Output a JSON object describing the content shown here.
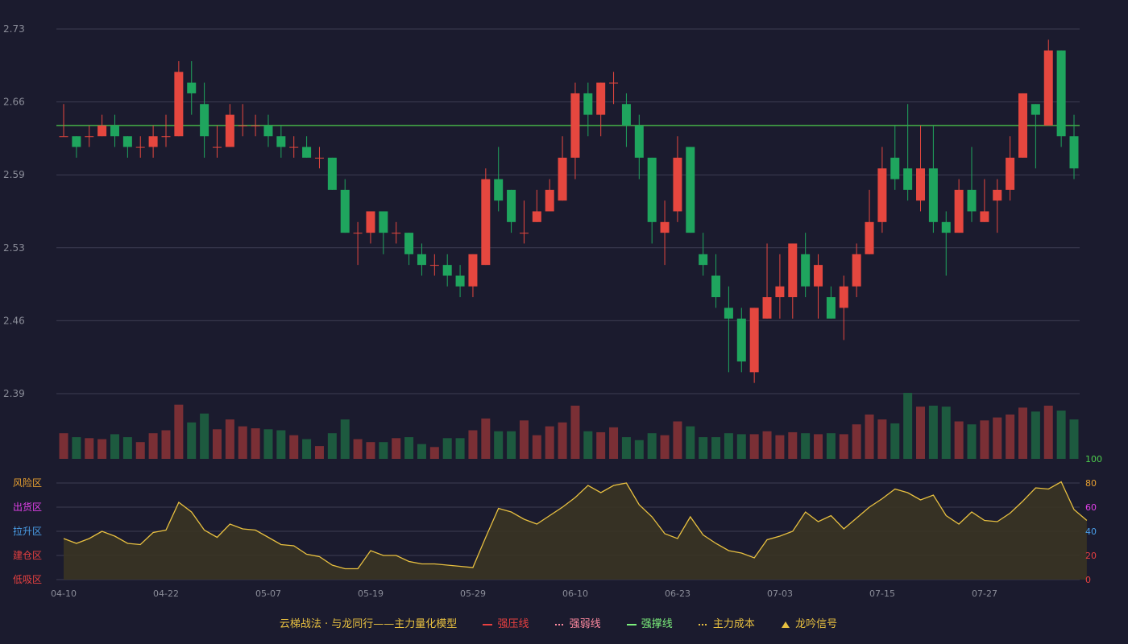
{
  "chart_data": {
    "type": "candlestick",
    "x_labels": [
      "04-10",
      "04-22",
      "05-07",
      "05-19",
      "05-29",
      "06-10",
      "06-23",
      "07-03",
      "07-15",
      "07-27"
    ],
    "price_axis": {
      "ticks": [
        "2.73",
        "2.66",
        "2.59",
        "2.53",
        "2.46",
        "2.39"
      ],
      "range": [
        2.39,
        2.73
      ]
    },
    "reference_line": 2.64,
    "candles": [
      [
        2.63,
        2.63,
        2.66,
        2.63
      ],
      [
        2.63,
        2.62,
        2.63,
        2.61
      ],
      [
        2.63,
        2.63,
        2.64,
        2.62
      ],
      [
        2.63,
        2.64,
        2.65,
        2.63
      ],
      [
        2.64,
        2.63,
        2.65,
        2.62
      ],
      [
        2.63,
        2.62,
        2.63,
        2.61
      ],
      [
        2.62,
        2.62,
        2.63,
        2.61
      ],
      [
        2.62,
        2.63,
        2.64,
        2.61
      ],
      [
        2.63,
        2.63,
        2.65,
        2.62
      ],
      [
        2.63,
        2.69,
        2.7,
        2.63
      ],
      [
        2.68,
        2.67,
        2.7,
        2.65
      ],
      [
        2.66,
        2.63,
        2.68,
        2.61
      ],
      [
        2.62,
        2.62,
        2.64,
        2.61
      ],
      [
        2.62,
        2.65,
        2.66,
        2.62
      ],
      [
        2.64,
        2.64,
        2.66,
        2.63
      ],
      [
        2.64,
        2.64,
        2.65,
        2.63
      ],
      [
        2.64,
        2.63,
        2.65,
        2.62
      ],
      [
        2.63,
        2.62,
        2.64,
        2.61
      ],
      [
        2.62,
        2.62,
        2.63,
        2.61
      ],
      [
        2.62,
        2.61,
        2.63,
        2.61
      ],
      [
        2.61,
        2.61,
        2.62,
        2.6
      ],
      [
        2.61,
        2.58,
        2.61,
        2.58
      ],
      [
        2.58,
        2.54,
        2.59,
        2.54
      ],
      [
        2.54,
        2.54,
        2.55,
        2.51
      ],
      [
        2.54,
        2.56,
        2.56,
        2.53
      ],
      [
        2.56,
        2.54,
        2.56,
        2.52
      ],
      [
        2.54,
        2.54,
        2.55,
        2.53
      ],
      [
        2.54,
        2.52,
        2.54,
        2.51
      ],
      [
        2.52,
        2.51,
        2.53,
        2.5
      ],
      [
        2.51,
        2.51,
        2.52,
        2.5
      ],
      [
        2.51,
        2.5,
        2.52,
        2.49
      ],
      [
        2.5,
        2.49,
        2.51,
        2.48
      ],
      [
        2.49,
        2.52,
        2.52,
        2.48
      ],
      [
        2.51,
        2.59,
        2.6,
        2.51
      ],
      [
        2.59,
        2.57,
        2.62,
        2.56
      ],
      [
        2.58,
        2.55,
        2.58,
        2.54
      ],
      [
        2.54,
        2.54,
        2.57,
        2.53
      ],
      [
        2.55,
        2.56,
        2.58,
        2.55
      ],
      [
        2.56,
        2.58,
        2.59,
        2.56
      ],
      [
        2.57,
        2.61,
        2.63,
        2.57
      ],
      [
        2.61,
        2.67,
        2.68,
        2.59
      ],
      [
        2.67,
        2.65,
        2.68,
        2.63
      ],
      [
        2.65,
        2.68,
        2.68,
        2.63
      ],
      [
        2.68,
        2.68,
        2.69,
        2.66
      ],
      [
        2.66,
        2.64,
        2.67,
        2.62
      ],
      [
        2.64,
        2.61,
        2.65,
        2.59
      ],
      [
        2.61,
        2.55,
        2.61,
        2.53
      ],
      [
        2.54,
        2.55,
        2.57,
        2.51
      ],
      [
        2.56,
        2.61,
        2.63,
        2.55
      ],
      [
        2.62,
        2.54,
        2.62,
        2.54
      ],
      [
        2.52,
        2.51,
        2.54,
        2.5
      ],
      [
        2.5,
        2.48,
        2.52,
        2.47
      ],
      [
        2.47,
        2.46,
        2.49,
        2.41
      ],
      [
        2.46,
        2.42,
        2.47,
        2.41
      ],
      [
        2.41,
        2.47,
        2.47,
        2.4
      ],
      [
        2.46,
        2.48,
        2.53,
        2.46
      ],
      [
        2.48,
        2.49,
        2.52,
        2.46
      ],
      [
        2.48,
        2.53,
        2.53,
        2.46
      ],
      [
        2.52,
        2.49,
        2.54,
        2.48
      ],
      [
        2.49,
        2.51,
        2.52,
        2.46
      ],
      [
        2.48,
        2.46,
        2.49,
        2.46
      ],
      [
        2.47,
        2.49,
        2.5,
        2.44
      ],
      [
        2.49,
        2.52,
        2.53,
        2.48
      ],
      [
        2.52,
        2.55,
        2.58,
        2.52
      ],
      [
        2.55,
        2.6,
        2.62,
        2.54
      ],
      [
        2.61,
        2.59,
        2.64,
        2.58
      ],
      [
        2.6,
        2.58,
        2.66,
        2.57
      ],
      [
        2.57,
        2.6,
        2.64,
        2.56
      ],
      [
        2.6,
        2.55,
        2.64,
        2.54
      ],
      [
        2.55,
        2.54,
        2.56,
        2.5
      ],
      [
        2.54,
        2.58,
        2.59,
        2.54
      ],
      [
        2.58,
        2.56,
        2.62,
        2.55
      ],
      [
        2.55,
        2.56,
        2.59,
        2.55
      ],
      [
        2.57,
        2.58,
        2.59,
        2.54
      ],
      [
        2.58,
        2.61,
        2.63,
        2.57
      ],
      [
        2.61,
        2.67,
        2.67,
        2.61
      ],
      [
        2.66,
        2.65,
        2.66,
        2.6
      ],
      [
        2.64,
        2.71,
        2.72,
        2.64
      ],
      [
        2.71,
        2.63,
        2.71,
        2.62
      ],
      [
        2.63,
        2.6,
        2.65,
        2.59
      ]
    ],
    "volumes": [
      26,
      22,
      21,
      20,
      25,
      22,
      17,
      26,
      29,
      55,
      37,
      46,
      30,
      40,
      33,
      31,
      30,
      29,
      24,
      20,
      13,
      26,
      40,
      20,
      17,
      17,
      21,
      22,
      15,
      12,
      21,
      21,
      29,
      41,
      28,
      28,
      39,
      24,
      33,
      37,
      54,
      28,
      27,
      32,
      22,
      19,
      26,
      24,
      38,
      33,
      22,
      22,
      26,
      25,
      25,
      28,
      24,
      27,
      26,
      25,
      26,
      25,
      35,
      45,
      40,
      36,
      67,
      53,
      54,
      53,
      38,
      35,
      39,
      42,
      45,
      52,
      48,
      54,
      49,
      40
    ],
    "indicator_axis": {
      "ticks": [
        "100",
        "80",
        "60",
        "40",
        "20",
        "0"
      ],
      "range": [
        0,
        100
      ]
    },
    "indicator_values": [
      34,
      30,
      34,
      40,
      36,
      30,
      29,
      39,
      41,
      64,
      56,
      41,
      35,
      46,
      42,
      41,
      35,
      29,
      28,
      21,
      19,
      12,
      9,
      9,
      24,
      20,
      20,
      15,
      13,
      13,
      12,
      11,
      10,
      35,
      59,
      56,
      50,
      46,
      53,
      60,
      68,
      78,
      72,
      78,
      80,
      62,
      52,
      38,
      34,
      52,
      37,
      30,
      24,
      22,
      18,
      33,
      36,
      40,
      56,
      48,
      53,
      42,
      51,
      60,
      67,
      75,
      72,
      66,
      70,
      53,
      46,
      56,
      49,
      48,
      55,
      65,
      76,
      75,
      81,
      58,
      49
    ],
    "zones": [
      "风险区",
      "出货区",
      "拉升区",
      "建仓区",
      "低吸区"
    ],
    "zone_colors": [
      "#e8a030",
      "#e040e8",
      "#4a9ee8",
      "#e84040",
      "#e84040"
    ],
    "colors": {
      "up": "#e5473f",
      "down": "#1fa55e",
      "vol_up": "#7a2f35",
      "vol_down": "#1d5a3f",
      "ref_line": "#4ccd4c",
      "indicator": "#e8c040",
      "grid": "#3c3c52",
      "axis_text": "#8a8c98"
    },
    "axis_tick_colors": [
      "#4ccd4c",
      "#e8a030",
      "#e040e8",
      "#4a9ee8",
      "#e84040",
      "#e84040"
    ]
  },
  "legend": {
    "title": "云梯战法 · 与龙同行——主力量化模型",
    "items": [
      {
        "label": "强压线",
        "color": "#e84040",
        "style": "solid"
      },
      {
        "label": "强弱线",
        "color": "#ff8aa0",
        "style": "dashed"
      },
      {
        "label": "强撑线",
        "color": "#7cf07c",
        "style": "solid"
      },
      {
        "label": "主力成本",
        "color": "#e8c040",
        "style": "dashed"
      },
      {
        "label": "龙吟信号",
        "color": "#e8c040",
        "style": "triangle"
      }
    ]
  }
}
